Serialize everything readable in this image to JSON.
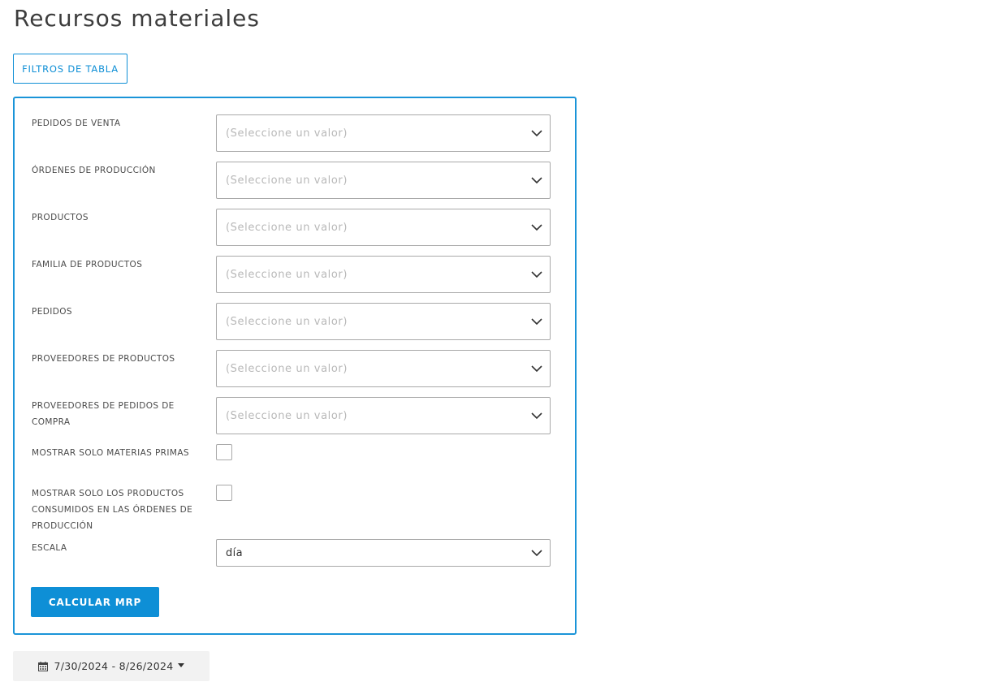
{
  "page": {
    "title": "Recursos materiales"
  },
  "toolbar": {
    "filters_label": "FILTROS DE TABLA"
  },
  "filters": {
    "selects": [
      {
        "label": "PEDIDOS DE VENTA",
        "placeholder": "(Seleccione un valor)"
      },
      {
        "label": "ÓRDENES DE PRODUCCIÓN",
        "placeholder": "(Seleccione un valor)"
      },
      {
        "label": "PRODUCTOS",
        "placeholder": "(Seleccione un valor)"
      },
      {
        "label": "FAMILIA DE PRODUCTOS",
        "placeholder": "(Seleccione un valor)"
      },
      {
        "label": "PEDIDOS",
        "placeholder": "(Seleccione un valor)"
      },
      {
        "label": "PROVEEDORES DE PRODUCTOS",
        "placeholder": "(Seleccione un valor)"
      },
      {
        "label": "PROVEEDORES DE PEDIDOS DE COMPRA",
        "placeholder": "(Seleccione un valor)"
      }
    ],
    "checkboxes": [
      {
        "label": "MOSTRAR SOLO MATERIAS PRIMAS",
        "checked": false
      },
      {
        "label": "MOSTRAR SOLO LOS PRODUCTOS CONSUMIDOS EN LAS ÓRDENES DE PRODUCCIÓN",
        "checked": false
      }
    ],
    "scale": {
      "label": "ESCALA",
      "value": "día"
    },
    "calculate_label": "CALCULAR MRP"
  },
  "date_range": {
    "value": "7/30/2024 - 8/26/2024",
    "icon": "calendar-icon"
  },
  "colors": {
    "accent": "#0e8fd6",
    "border": "#a9a9a9",
    "placeholder": "#b8b8b8"
  }
}
